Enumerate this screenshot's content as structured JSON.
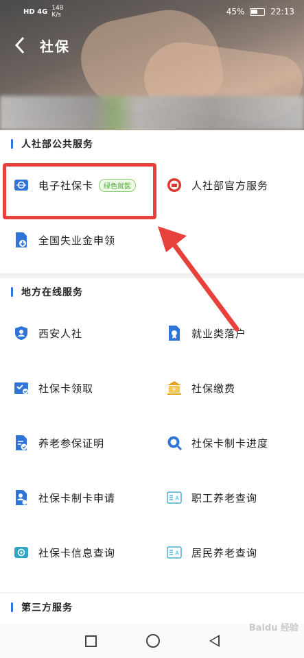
{
  "status": {
    "network": "HD 4G",
    "speed": "148\nK/s",
    "battery": "45%",
    "time": "22:13"
  },
  "nav": {
    "back_icon": "chevron-left-icon",
    "title": "社保"
  },
  "sections": {
    "public": {
      "title": "人社部公共服务",
      "items": [
        {
          "label": "电子社保卡",
          "tag": "绿色就医",
          "icon": "card-icon",
          "color": "#2f74d6"
        },
        {
          "label": "人社部官方服务",
          "icon": "emblem-icon",
          "color": "#d93a30"
        },
        {
          "label": "全国失业金申领",
          "icon": "document-download-icon",
          "color": "#2f74d6"
        }
      ]
    },
    "local": {
      "title": "地方在线服务",
      "items": [
        {
          "label": "西安人社",
          "icon": "shield-person-icon",
          "color": "#2f74d6"
        },
        {
          "label": "就业类落户",
          "icon": "document-medal-icon",
          "color": "#2f74d6"
        },
        {
          "label": "社保卡领取",
          "icon": "inbox-check-icon",
          "color": "#2f74d6"
        },
        {
          "label": "社保缴费",
          "icon": "bank-icon",
          "color": "#e2a41c"
        },
        {
          "label": "养老参保证明",
          "icon": "document-check-icon",
          "color": "#2f74d6"
        },
        {
          "label": "社保卡制卡进度",
          "icon": "search-progress-icon",
          "color": "#2f74d6"
        },
        {
          "label": "社保卡制卡申请",
          "icon": "document-person-icon",
          "color": "#2f74d6"
        },
        {
          "label": "职工养老查询",
          "icon": "id-card-icon",
          "color": "#4aaed6"
        },
        {
          "label": "社保卡信息查询",
          "icon": "card-search-icon",
          "color": "#2fa6c8"
        },
        {
          "label": "居民养老查询",
          "icon": "id-card-icon",
          "color": "#4aaed6"
        }
      ]
    },
    "third": {
      "title": "第三方服务"
    }
  },
  "system_nav": {
    "recent": "square-icon",
    "home": "circle-icon",
    "back": "triangle-back-icon"
  },
  "watermark": "Baidu 经验"
}
